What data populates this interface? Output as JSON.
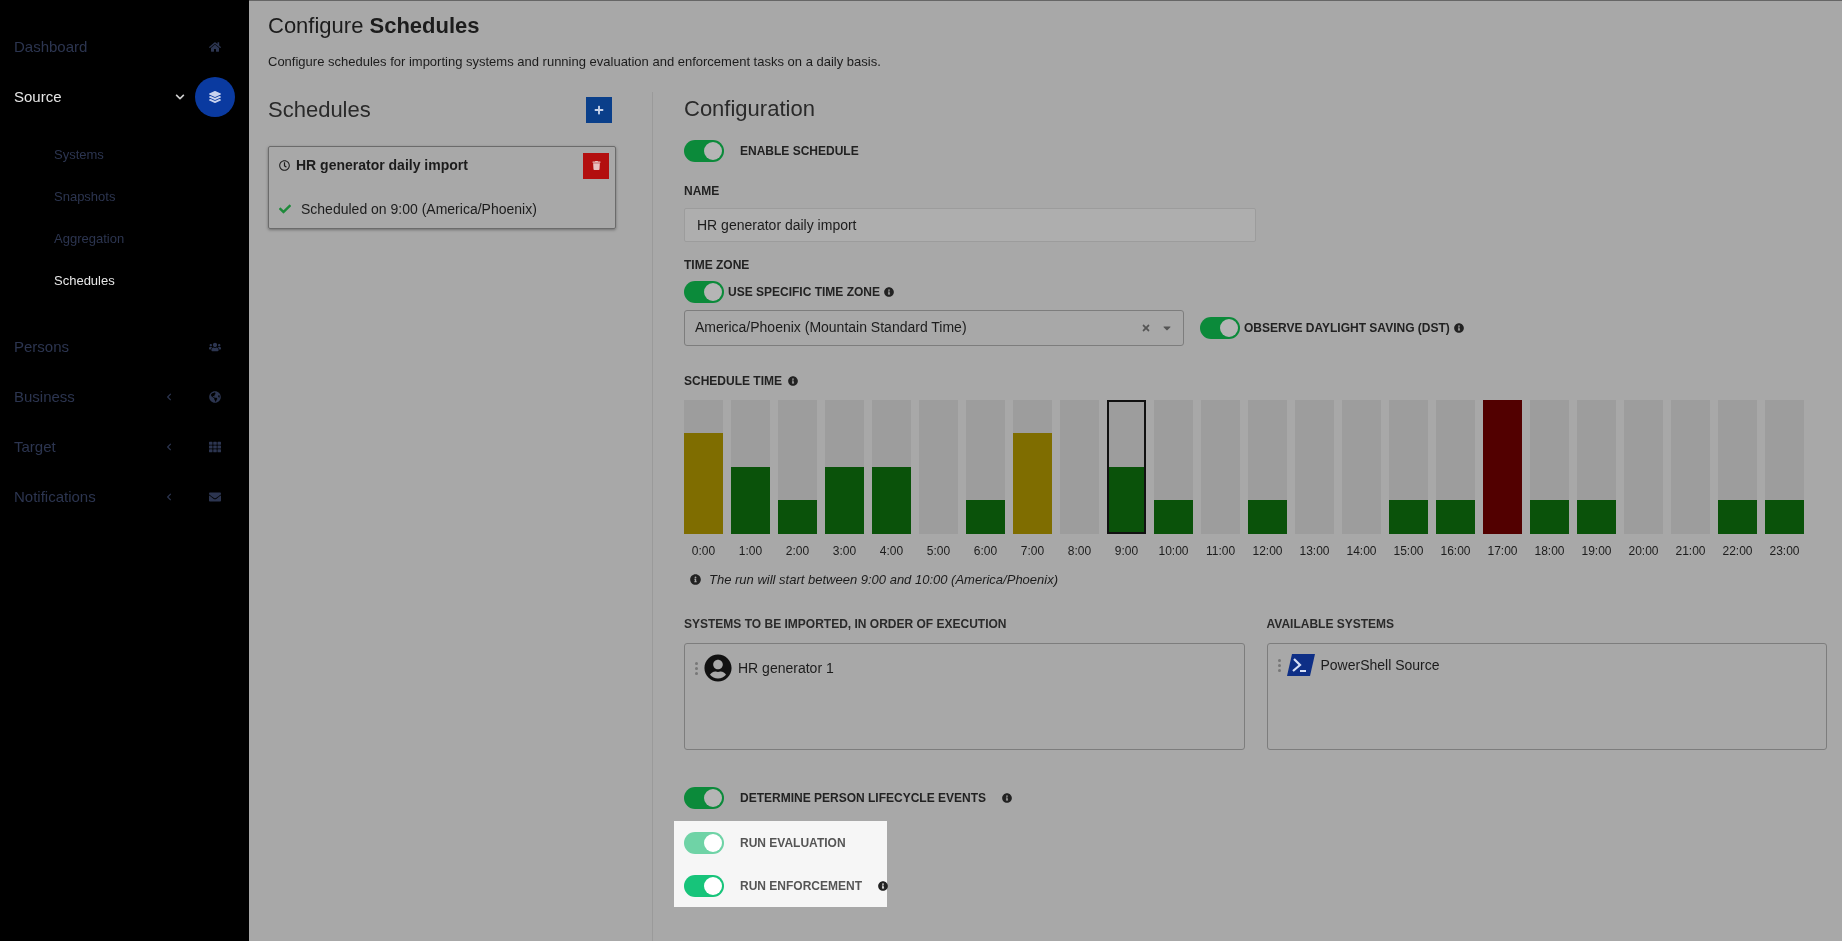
{
  "sidebar": {
    "items": [
      {
        "label": "Dashboard",
        "selected": false
      },
      {
        "label": "Source",
        "selected": true,
        "expanded": true,
        "children": [
          {
            "label": "Systems",
            "selected": false
          },
          {
            "label": "Snapshots",
            "selected": false
          },
          {
            "label": "Aggregation",
            "selected": false
          },
          {
            "label": "Schedules",
            "selected": true
          }
        ]
      },
      {
        "label": "Persons",
        "selected": false
      },
      {
        "label": "Business",
        "selected": false,
        "expanded": false
      },
      {
        "label": "Target",
        "selected": false,
        "expanded": false
      },
      {
        "label": "Notifications",
        "selected": false,
        "expanded": false
      }
    ]
  },
  "page": {
    "title": "Configure",
    "title_bold": "Schedules",
    "description": "Configure schedules for importing systems and running evaluation and enforcement tasks on a daily basis."
  },
  "schedules": {
    "heading": "Schedules",
    "items": [
      {
        "name": "HR generator daily import",
        "status": "Scheduled on 9:00 (America/Phoenix)",
        "selected": true
      }
    ]
  },
  "configuration": {
    "heading": "Configuration",
    "enable": {
      "label": "ENABLE SCHEDULE",
      "on": true
    },
    "name": {
      "label": "NAME",
      "value": "HR generator daily import"
    },
    "time_zone": {
      "label": "TIME ZONE",
      "specific": {
        "label": "USE SPECIFIC TIME ZONE",
        "on": true
      },
      "value": "America/Phoenix (Mountain Standard Time)",
      "dst": {
        "label": "OBSERVE DAYLIGHT SAVING (DST)",
        "on": true
      }
    },
    "schedule_time": {
      "label": "SCHEDULE TIME",
      "hours": [
        {
          "label": "0:00",
          "level": 0.75,
          "color": "#7f6d00",
          "selected": false
        },
        {
          "label": "1:00",
          "level": 0.5,
          "color": "#0a520a",
          "selected": false
        },
        {
          "label": "2:00",
          "level": 0.25,
          "color": "#0a520a",
          "selected": false
        },
        {
          "label": "3:00",
          "level": 0.5,
          "color": "#0a520a",
          "selected": false
        },
        {
          "label": "4:00",
          "level": 0.5,
          "color": "#0a520a",
          "selected": false
        },
        {
          "label": "5:00",
          "selected": false
        },
        {
          "label": "6:00",
          "level": 0.25,
          "color": "#0a520a",
          "selected": false
        },
        {
          "label": "7:00",
          "level": 0.75,
          "color": "#7f6d00",
          "selected": false
        },
        {
          "label": "8:00",
          "selected": false
        },
        {
          "label": "9:00",
          "level": 0.5,
          "color": "#0a520a",
          "selected": true
        },
        {
          "label": "10:00",
          "level": 0.25,
          "color": "#0a520a",
          "selected": false
        },
        {
          "label": "11:00",
          "selected": false
        },
        {
          "label": "12:00",
          "level": 0.25,
          "color": "#0a520a",
          "selected": false
        },
        {
          "label": "13:00",
          "selected": false
        },
        {
          "label": "14:00",
          "selected": false
        },
        {
          "label": "15:00",
          "level": 0.25,
          "color": "#0a520a",
          "selected": false
        },
        {
          "label": "16:00",
          "level": 0.25,
          "color": "#0a520a",
          "selected": false
        },
        {
          "label": "17:00",
          "level": 1,
          "color": "#520000",
          "selected": false
        },
        {
          "label": "18:00",
          "level": 0.25,
          "color": "#0a520a",
          "selected": false
        },
        {
          "label": "19:00",
          "level": 0.25,
          "color": "#0a520a",
          "selected": false
        },
        {
          "label": "20:00",
          "selected": false
        },
        {
          "label": "21:00",
          "selected": false
        },
        {
          "label": "22:00",
          "level": 0.25,
          "color": "#0a520a",
          "selected": false
        },
        {
          "label": "23:00",
          "level": 0.25,
          "color": "#0a520a",
          "selected": false
        }
      ],
      "note": "The run will start between 9:00 and 10:00 (America/Phoenix)"
    },
    "imported": {
      "label": "SYSTEMS TO BE IMPORTED, IN ORDER OF EXECUTION",
      "items": [
        {
          "name": "HR generator 1",
          "kind": "person"
        }
      ]
    },
    "available": {
      "label": "AVAILABLE SYSTEMS",
      "items": [
        {
          "name": "PowerShell Source",
          "kind": "powershell"
        }
      ]
    },
    "toggles": [
      {
        "label": "DETERMINE PERSON LIFECYCLE EVENTS",
        "on": true,
        "info": true,
        "highlighted": false,
        "disabled": false
      },
      {
        "label": "RUN EVALUATION",
        "on": true,
        "info": false,
        "highlighted": true,
        "disabled": true
      },
      {
        "label": "RUN ENFORCEMENT",
        "on": true,
        "info": true,
        "highlighted": true,
        "disabled": false
      }
    ]
  }
}
